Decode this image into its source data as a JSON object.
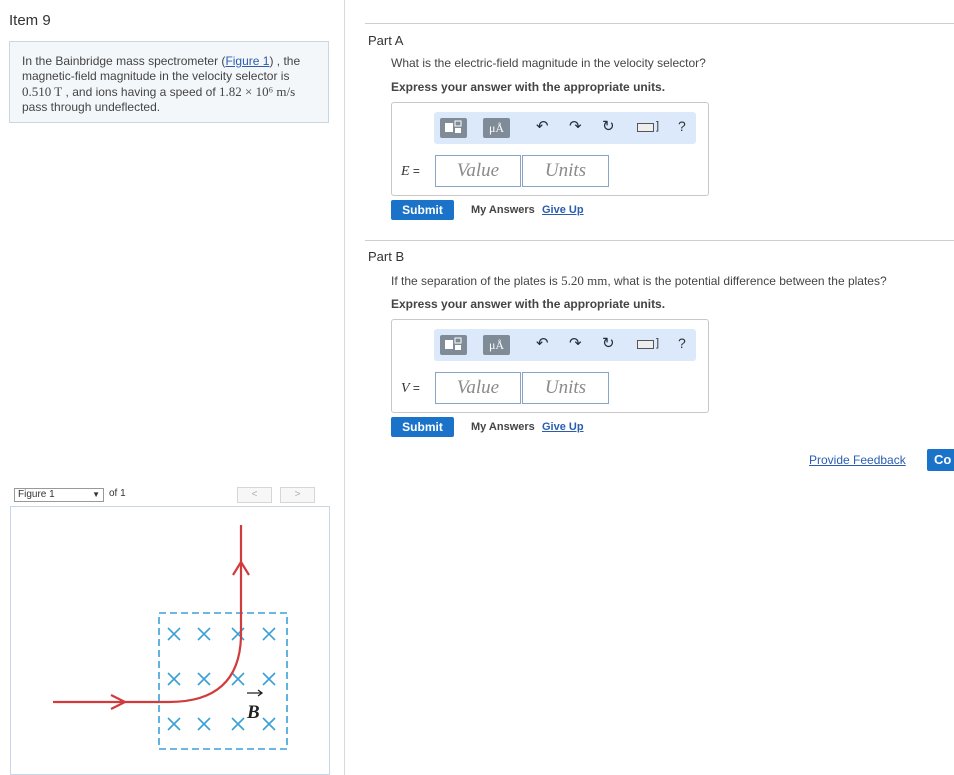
{
  "item": {
    "title": "Item 9"
  },
  "problem": {
    "text_1": "In the Bainbridge mass spectrometer (",
    "figure_link": "Figure 1",
    "text_2": ") , the magnetic-field magnitude in the velocity selector is ",
    "b_value": "0.510 T",
    "text_3": " , and ions having a speed of ",
    "speed_value": "1.82 × 10⁶ m/s",
    "text_4": " pass through undeflected."
  },
  "figure": {
    "select_label": "Figure 1",
    "of_label": "of 1",
    "prev": "<",
    "next": ">",
    "b_label": "B"
  },
  "parts": {
    "a": {
      "title": "Part A",
      "question": "What is the electric-field magnitude in the velocity selector?",
      "express": "Express your answer with the appropriate units.",
      "variable": "E",
      "eq": " =",
      "value_placeholder": "Value",
      "units_placeholder": "Units",
      "submit": "Submit",
      "my_answers": "My Answers",
      "give_up": "Give Up"
    },
    "b": {
      "title": "Part B",
      "question_1": "If the separation of the plates is ",
      "separation": "5.20 mm",
      "question_2": ", what is the potential difference between the plates?",
      "express": "Express your answer with the appropriate units.",
      "variable": "V",
      "eq": " =",
      "value_placeholder": "Value",
      "units_placeholder": "Units",
      "submit": "Submit",
      "my_answers": "My Answers",
      "give_up": "Give Up"
    }
  },
  "toolbar": {
    "units_icon_text": "μÅ",
    "undo": "↶",
    "redo": "↷",
    "reset": "↻",
    "bracket": "]",
    "help": "?"
  },
  "footer": {
    "provide_feedback": "Provide Feedback",
    "continue": "Co"
  },
  "colors": {
    "accent": "#1a73c9",
    "link": "#2a5db0",
    "ion_path": "#d13b3b",
    "field_region": "#3aa0d8",
    "toolbar_bg": "#dbe9fa"
  }
}
